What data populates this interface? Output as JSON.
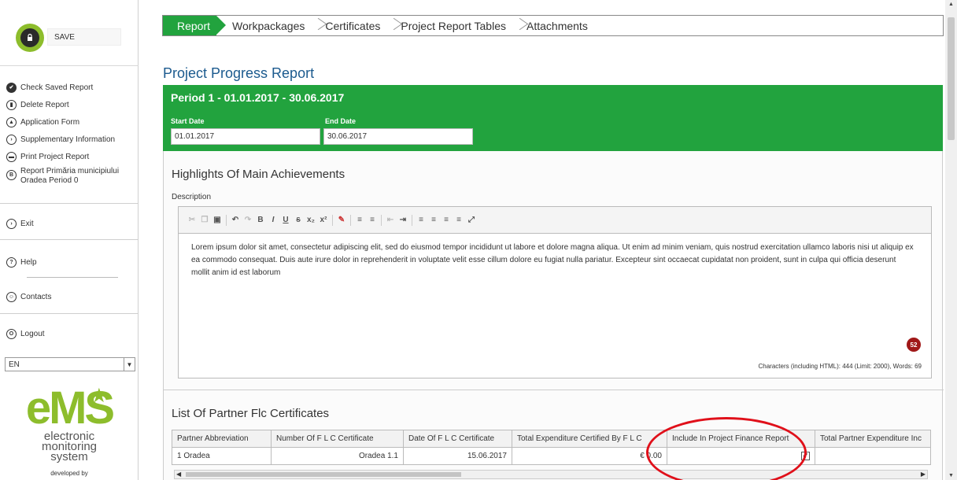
{
  "sidebar": {
    "save_label": "SAVE",
    "menu": [
      {
        "label": "Check Saved Report",
        "icon": "check-icon"
      },
      {
        "label": "Delete Report",
        "icon": "trash-icon"
      },
      {
        "label": "Application Form",
        "icon": "form-icon"
      },
      {
        "label": "Supplementary Information",
        "icon": "info-icon"
      },
      {
        "label": "Print Project Report",
        "icon": "print-icon"
      },
      {
        "label": "Report Primăria municipiului Oradea Period 0",
        "icon": "report-icon"
      }
    ],
    "exit_label": "Exit",
    "help_label": "Help",
    "contacts_label": "Contacts",
    "logout_label": "Logout",
    "language": "EN",
    "brand": {
      "big": "eMS",
      "line1": "electronic",
      "line2": "monitoring",
      "line3": "system",
      "developed_by": "developed by"
    }
  },
  "tabs": [
    "Report",
    "Workpackages",
    "Certificates",
    "Project Report Tables",
    "Attachments"
  ],
  "active_tab": "Report",
  "page_title": "Project Progress Report",
  "period": {
    "title": "Period 1 - 01.01.2017 - 30.06.2017",
    "start_label": "Start Date",
    "start_value": "01.01.2017",
    "end_label": "End Date",
    "end_value": "30.06.2017"
  },
  "highlights": {
    "title": "Highlights Of Main Achievements",
    "description_label": "Description",
    "text": "Lorem ipsum dolor sit amet, consectetur adipiscing elit, sed do eiusmod tempor incididunt ut labore et dolore magna aliqua. Ut enim ad minim veniam, quis nostrud exercitation ullamco laboris nisi ut aliquip ex ea commodo consequat. Duis aute irure dolor in reprehenderit in voluptate velit esse cillum dolore eu fugiat nulla pariatur. Excepteur sint occaecat cupidatat non proident, sunt in culpa qui officia deserunt mollit anim id est laborum",
    "badge": "52",
    "char_count": "Characters (including HTML): 444 (Limit: 2000), Words: 69"
  },
  "certificates": {
    "title": "List Of Partner Flc Certificates",
    "columns": [
      "Partner Abbreviation",
      "Number Of F L C Certificate",
      "Date Of F L C Certificate",
      "Total Expenditure Certified By F L C",
      "Include In Project Finance Report",
      "Total Partner Expenditure Inc"
    ],
    "rows": [
      {
        "partner": "1 Oradea",
        "number": "Oradea 1.1",
        "date": "15.06.2017",
        "total": "€ 0.00",
        "include": "✔",
        "partner_total": ""
      }
    ]
  },
  "colors": {
    "accent": "#22a33e",
    "title_blue": "#1b5a8e",
    "brand_green": "#8dbd2c",
    "highlight_red": "#e0101a"
  }
}
